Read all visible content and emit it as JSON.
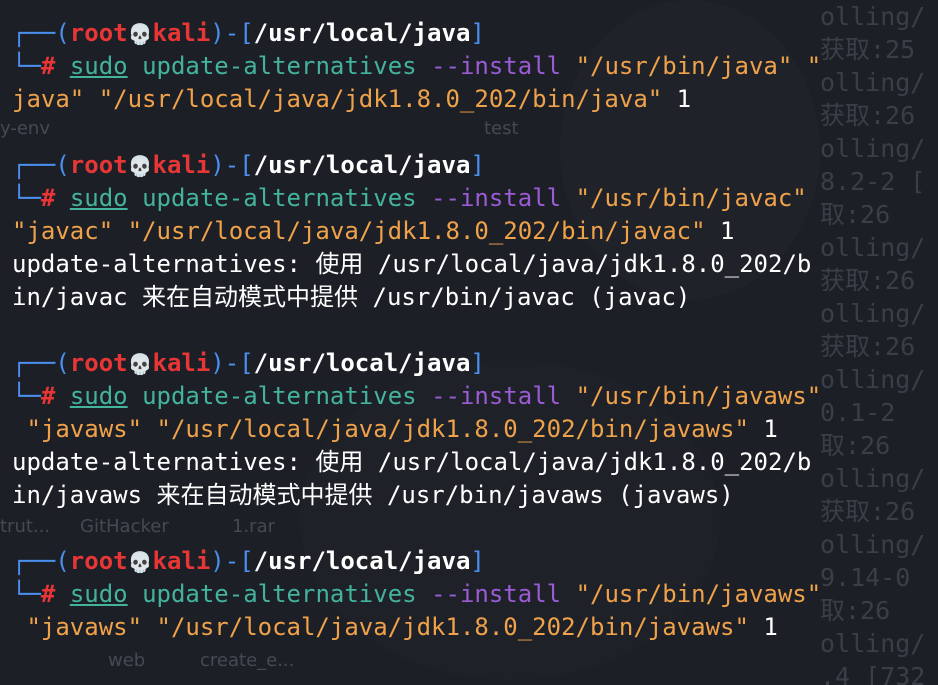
{
  "terminal": {
    "blocks": [
      {
        "prompt": {
          "user": "root",
          "skull": "💀",
          "host": "kali",
          "path": "/usr/local/java",
          "symbol": "#"
        },
        "command": "sudo",
        "program": "update-alternatives",
        "option": "--install",
        "wrap1": "\"/usr/bin/java\" \"",
        "line2": "java\" \"/usr/local/java/jdk1.8.0_202/bin/java\"",
        "priority": "1",
        "output": []
      },
      {
        "prompt": {
          "user": "root",
          "skull": "💀",
          "host": "kali",
          "path": "/usr/local/java",
          "symbol": "#"
        },
        "command": "sudo",
        "program": "update-alternatives",
        "option": "--install",
        "wrap1": "\"/usr/bin/javac\"",
        "line2": "\"javac\" \"/usr/local/java/jdk1.8.0_202/bin/javac\"",
        "priority": "1",
        "output": [
          "update-alternatives: 使用 /usr/local/java/jdk1.8.0_202/b",
          "in/javac 来在自动模式中提供 /usr/bin/javac (javac)"
        ]
      },
      {
        "prompt": {
          "user": "root",
          "skull": "💀",
          "host": "kali",
          "path": "/usr/local/java",
          "symbol": "#"
        },
        "command": "sudo",
        "program": "update-alternatives",
        "option": "--install",
        "wrap1": "\"/usr/bin/javaws\"",
        "line2": " \"javaws\" \"/usr/local/java/jdk1.8.0_202/bin/javaws\"",
        "priority": "1",
        "output": [
          "update-alternatives: 使用 /usr/local/java/jdk1.8.0_202/b",
          "in/javaws 来在自动模式中提供 /usr/bin/javaws (javaws)"
        ]
      },
      {
        "prompt": {
          "user": "root",
          "skull": "💀",
          "host": "kali",
          "path": "/usr/local/java",
          "symbol": "#"
        },
        "command": "sudo",
        "program": "update-alternatives",
        "option": "--install",
        "wrap1": "\"/usr/bin/javaws\"",
        "line2": " \"javaws\" \"/usr/local/java/jdk1.8.0_202/bin/javaws\"",
        "priority": "1",
        "output": []
      }
    ]
  },
  "background": {
    "right_text": [
      "olling/",
      "获取:25",
      "olling/",
      "获取:26",
      "olling/",
      "8.2-2 [",
      "取:26",
      "olling/",
      "获取:26",
      "olling/",
      "获取:26",
      "olling/",
      "0.1-2",
      "取:26",
      "olling/",
      "获取:26",
      "olling/",
      "9.14-0",
      "取:26",
      "olling/",
      ".4 [732"
    ],
    "labels": [
      "y-env",
      "test",
      "trut...",
      "GitHacker",
      "1.rar",
      "web",
      "create_e..."
    ]
  }
}
